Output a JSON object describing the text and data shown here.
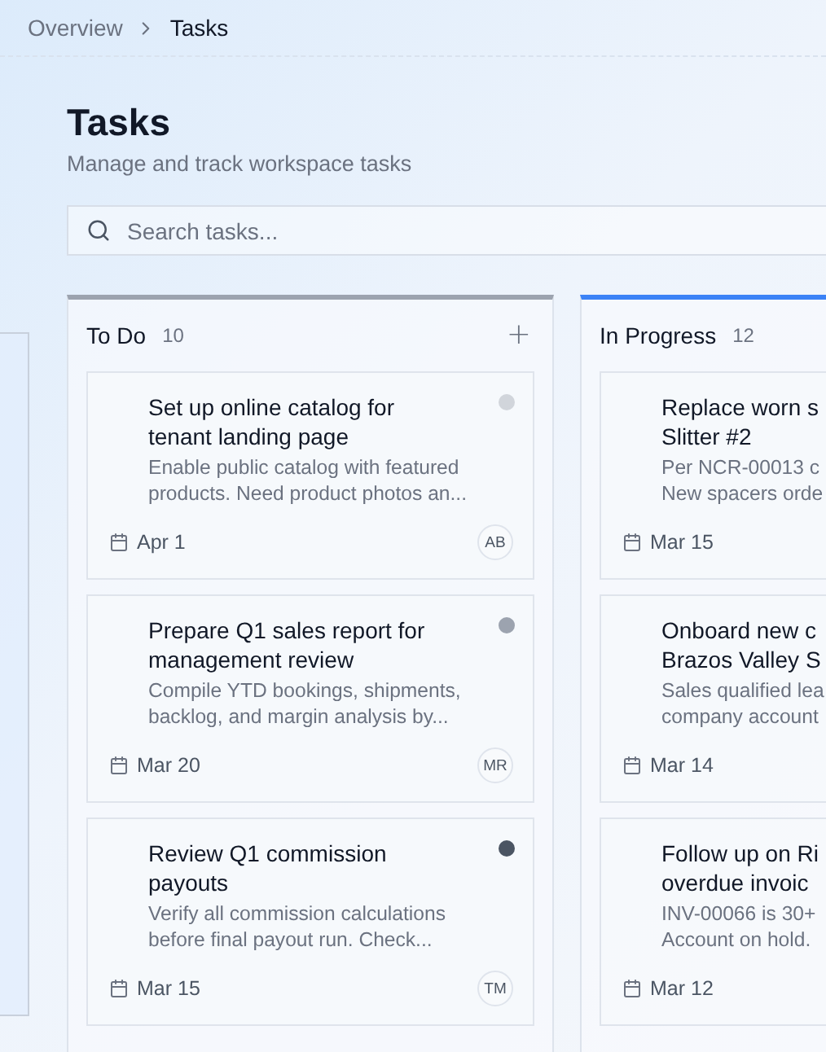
{
  "breadcrumb": [
    {
      "label": "Overview",
      "current": false
    },
    {
      "label": "Tasks",
      "current": true
    }
  ],
  "title": "Tasks",
  "subtitle": "Manage and track workspace tasks",
  "search": {
    "placeholder": "Search tasks..."
  },
  "columns": [
    {
      "name": "To Do",
      "count": "10",
      "color": "#9ca3af",
      "add_label": "+",
      "cards": [
        {
          "title_lines": [
            "Set up online catalog for",
            "tenant landing page"
          ],
          "description_lines": [
            "Enable public catalog with featured",
            "products. Need product photos an..."
          ],
          "date": "Apr 1",
          "assignee": "AB",
          "color": "#d1d5db"
        },
        {
          "title_lines": [
            "Prepare Q1 sales report for",
            "management review"
          ],
          "description_lines": [
            "Compile YTD bookings, shipments,",
            "backlog, and margin analysis by..."
          ],
          "date": "Mar 20",
          "assignee": "MR",
          "color": "#9ca3af"
        },
        {
          "title_lines": [
            "Review Q1 commission",
            "payouts"
          ],
          "description_lines": [
            "Verify all commission calculations",
            "before final payout run. Check..."
          ],
          "date": "Mar 15",
          "assignee": "TM",
          "color": "#4b5563"
        }
      ]
    },
    {
      "name": "In Progress",
      "count": "12",
      "color": "#3b82f6",
      "cards": [
        {
          "title_lines": [
            "Replace worn s",
            "Slitter #2"
          ],
          "description_lines": [
            "Per NCR-00013 c",
            "New spacers orde"
          ],
          "date": "Mar 15"
        },
        {
          "title_lines": [
            "Onboard new c",
            "Brazos Valley S"
          ],
          "description_lines": [
            "Sales qualified lea",
            "company account"
          ],
          "date": "Mar 14"
        },
        {
          "title_lines": [
            "Follow up on Ri",
            "overdue invoic"
          ],
          "description_lines": [
            "INV-00066 is 30+",
            "Account on hold."
          ],
          "date": "Mar 12"
        }
      ]
    }
  ]
}
